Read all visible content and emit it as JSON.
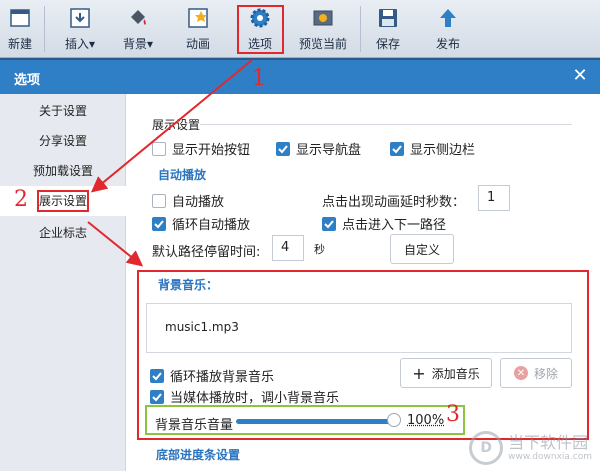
{
  "toolbar": {
    "items": [
      {
        "label": "新建",
        "icon": "new-window-icon"
      },
      {
        "label": "插入▾",
        "icon": "insert-icon"
      },
      {
        "label": "背景▾",
        "icon": "paint-bucket-icon"
      },
      {
        "label": "动画",
        "icon": "animation-icon"
      },
      {
        "label": "选项",
        "icon": "gear-icon"
      },
      {
        "label": "预览当前",
        "icon": "preview-icon"
      },
      {
        "label": "保存",
        "icon": "save-icon"
      },
      {
        "label": "发布",
        "icon": "publish-arrow-icon"
      }
    ]
  },
  "dialog": {
    "title": "选项",
    "close": "✕"
  },
  "nav": {
    "items": [
      "关于设置",
      "分享设置",
      "预加载设置",
      "展示设置",
      "企业标志"
    ],
    "active_index": 3
  },
  "display": {
    "section_title": "展示设置",
    "show_start": "显示开始按钮",
    "show_start_checked": false,
    "show_nav": "显示导航盘",
    "show_nav_checked": true,
    "show_sidebar": "显示侧边栏",
    "show_sidebar_checked": true
  },
  "autoplay": {
    "section_title": "自动播放",
    "auto_play": "自动播放",
    "auto_play_checked": false,
    "loop_auto": "循环自动播放",
    "loop_auto_checked": true,
    "delay_label": "点击出现动画延时秒数：",
    "delay_value": "1",
    "click_next": "点击进入下一路径",
    "click_next_checked": true,
    "stay_label": "默认路径停留时间:",
    "stay_value": "4",
    "stay_unit": "秒",
    "custom_button": "自定义"
  },
  "bgm": {
    "section_title": "背景音乐：",
    "music_file": "music1.mp3",
    "loop_music": "循环播放背景音乐",
    "loop_music_checked": true,
    "duck_music": "当媒体播放时，调小背景音乐",
    "duck_music_checked": true,
    "add_button": "添加音乐",
    "remove_button": "移除",
    "volume_label": "背景音乐音量",
    "volume_value": "100%",
    "volume_fraction": 1.0
  },
  "bottom_section": "底部进度条设置",
  "annotations": [
    "1",
    "2",
    "3"
  ],
  "watermark": {
    "text": "当下软件园",
    "url": "www.downxia.com"
  },
  "colors": {
    "accent": "#2f7fc6",
    "highlight_red": "#e0282e",
    "highlight_green": "#8ac440"
  }
}
